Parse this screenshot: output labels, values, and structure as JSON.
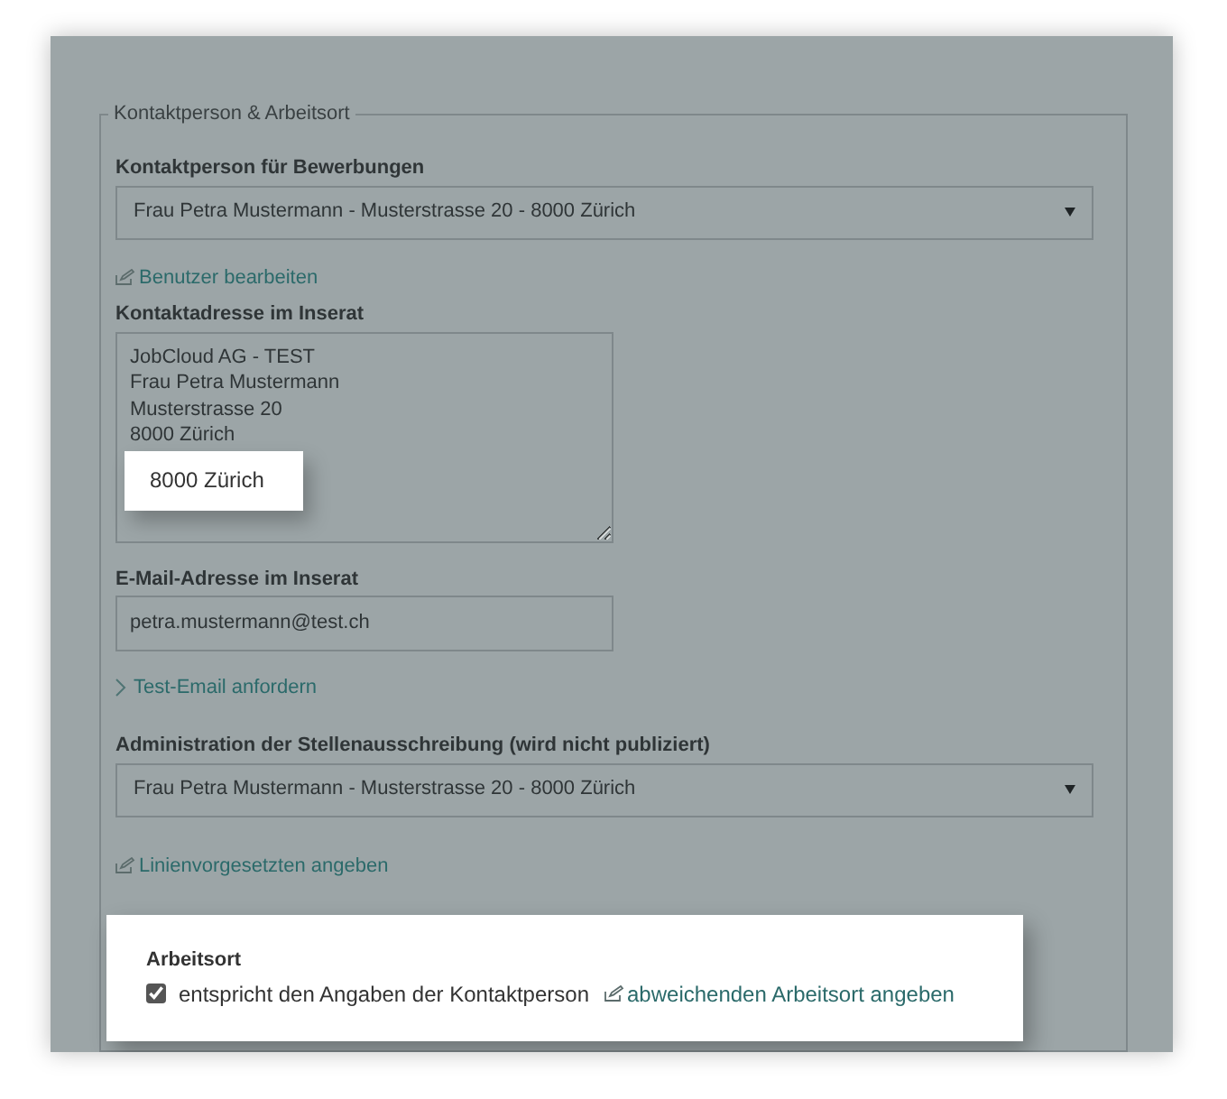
{
  "fieldset": {
    "legend": "Kontaktperson & Arbeitsort"
  },
  "contact_person": {
    "label": "Kontaktperson für Bewerbungen",
    "value": "Frau Petra Mustermann - Musterstrasse 20 - 8000 Zürich"
  },
  "edit_user_link": "Benutzer bearbeiten",
  "contact_address": {
    "label": "Kontaktadresse im Inserat",
    "lines": [
      "JobCloud AG - TEST",
      "Frau Petra Mustermann",
      "Musterstrasse 20",
      "8000 Zürich"
    ]
  },
  "callout": "8000 Zürich",
  "email": {
    "label": "E-Mail-Adresse im Inserat",
    "value": "petra.mustermann@test.ch"
  },
  "test_email_link": "Test-Email anfordern",
  "administration": {
    "label": "Administration der Stellenausschreibung (wird nicht publiziert)",
    "value": "Frau Petra Mustermann - Musterstrasse 20 - 8000 Zürich"
  },
  "supervisor_link": "Linienvorgesetzten angeben",
  "work_location": {
    "label": "Arbeitsort",
    "checkbox": {
      "label": "entspricht den Angaben der Kontaktperson",
      "checked": true
    },
    "link": "abweichenden Arbeitsort angeben"
  }
}
